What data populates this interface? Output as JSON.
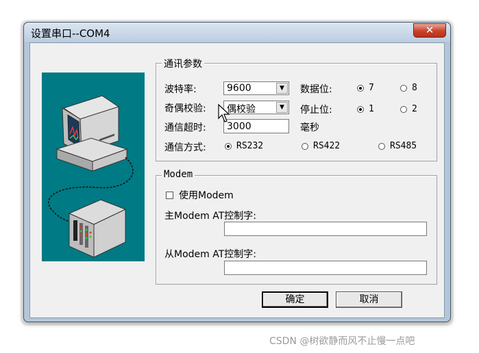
{
  "window": {
    "title": "设置串口--COM4",
    "close_glyph": "✕"
  },
  "comm_params": {
    "group_title": "通讯参数",
    "baud_label": "波特率:",
    "baud_value": "9600",
    "parity_label": "奇偶校验:",
    "parity_value": "偶校验",
    "timeout_label": "通信超时:",
    "timeout_value": "3000",
    "timeout_unit": "毫秒",
    "mode_label": "通信方式:",
    "modes": [
      "RS232",
      "RS422",
      "RS485"
    ],
    "mode_selected": "RS232",
    "databits_label": "数据位:",
    "databits_options": [
      "7",
      "8"
    ],
    "databits_selected": "7",
    "stopbits_label": "停止位:",
    "stopbits_options": [
      "1",
      "2"
    ],
    "stopbits_selected": "1"
  },
  "modem": {
    "group_title": "Modem",
    "use_modem_label": "使用Modem",
    "use_modem_checked": false,
    "main_at_label": "主Modem AT控制字:",
    "main_at_value": "",
    "slave_at_label": "从Modem AT控制字:",
    "slave_at_value": ""
  },
  "buttons": {
    "ok": "确定",
    "cancel": "取消"
  },
  "watermark": "CSDN @树欲静而风不止慢一点吧",
  "icons": [
    "computer-illustration",
    "plc-device-illustration",
    "close-icon",
    "mouse-cursor-icon"
  ]
}
